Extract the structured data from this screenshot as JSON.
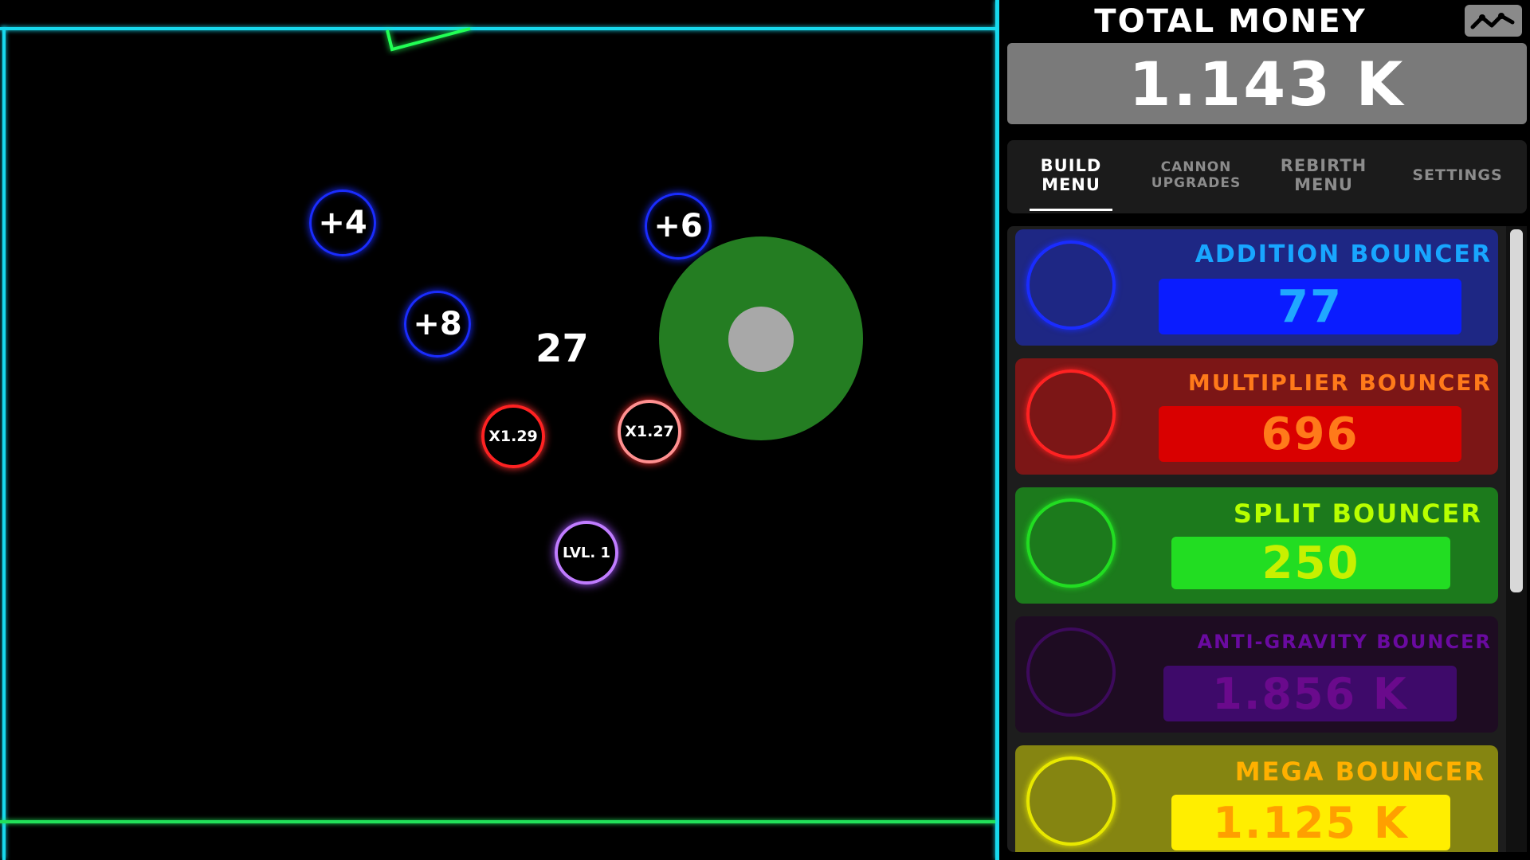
{
  "field": {
    "floating_number": "27",
    "addition_bouncers": [
      "+4",
      "+6",
      "+8"
    ],
    "multiplier_bouncers": [
      "X1.29",
      "X1.27"
    ],
    "level_bouncer": "LVL. 1"
  },
  "header": {
    "title": "TOTAL MONEY",
    "money": "1.143 K",
    "stats_icon": "graph-line-icon"
  },
  "tabs": [
    {
      "label_line1": "BUILD",
      "label_line2": "MENU",
      "active": true
    },
    {
      "label_line1": "CANNON",
      "label_line2": "UPGRADES",
      "active": false
    },
    {
      "label_line1": "REBIRTH",
      "label_line2": "MENU",
      "active": false
    },
    {
      "label_line1": "SETTINGS",
      "label_line2": "",
      "active": false
    }
  ],
  "build_items": [
    {
      "name": "ADDITION BOUNCER",
      "price": "77"
    },
    {
      "name": "MULTIPLIER BOUNCER",
      "price": "696"
    },
    {
      "name": "SPLIT BOUNCER",
      "price": "250"
    },
    {
      "name": "ANTI-GRAVITY BOUNCER",
      "price": "1.856 K"
    },
    {
      "name": "MEGA BOUNCER",
      "price": "1.125 K"
    }
  ],
  "colors": {
    "wall": "#17d9ee",
    "floor": "#22e05a",
    "addition": "#1a2cff",
    "multiplier": "#ff2222",
    "split": "#22dd22",
    "anti_gravity": "#6a0aa0",
    "mega": "#e8e800"
  }
}
